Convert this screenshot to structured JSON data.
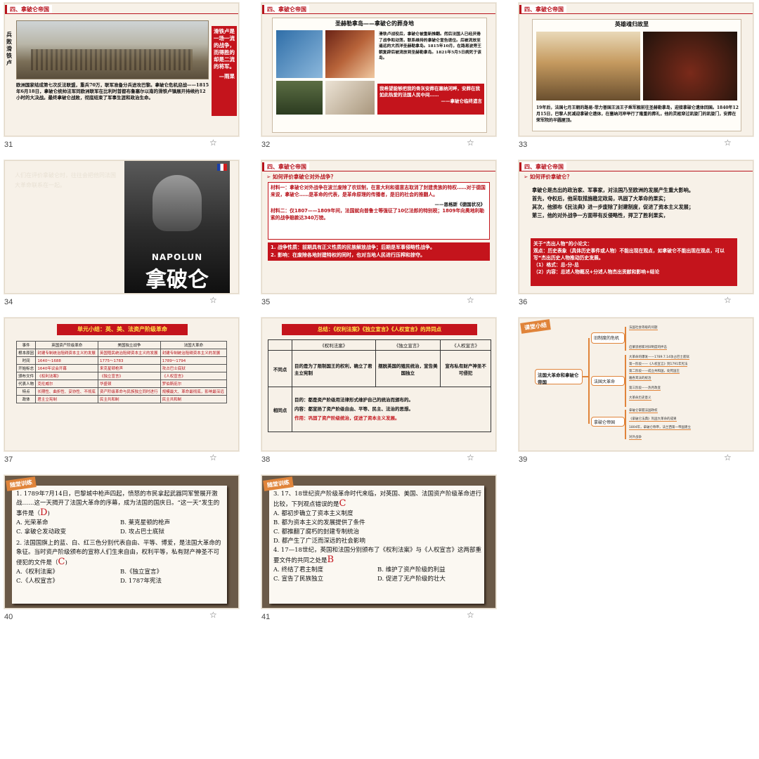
{
  "colors": {
    "accent_red": "#c4141c",
    "section_red": "#b8131c",
    "slide_bg": "#f7f1e8",
    "mind_orange": "#e0843a"
  },
  "slides": [
    {
      "num": "31",
      "section": "四、拿破仑帝国",
      "side_label": "兵败滑铁卢",
      "body": "欧洲国家结成第七次反法联盟，重兵70万，联军准备分兵进攻巴黎。拿破仑危机迎战——1815年6月18日，拿破仑统帅法军同欧洲联军在比利时首都布鲁塞尔以南的滑铁卢镇展开持续约12小时的大决战。最终拿破仑战败，彻底结束了军事生涯和政治生命。",
      "quote": "滑铁卢是一场一流的战争，而得胜的却是二流的将军。",
      "quote_author": "—雨果"
    },
    {
      "num": "32",
      "section": "四、拿破仑帝国",
      "heading": "圣赫勒拿岛——拿破仑的葬身地",
      "body": "滑铁卢战役后，拿破仑被重新推翻。然后法国人已经厌倦了战争和动荡，联系维持的拿破仑宣告退位。后被流放至遥远的大西洋圣赫勒拿岛。1815年10月，在路易波旁王朝复辟后被流放到圣赫勒拿岛。1821年5月5日病死于该岛。",
      "redbox": "我希望能够把我的骨灰安葬在塞纳河畔，安葬在我如此热爱的法国人民中间……",
      "redbox_author": "——拿破仑临终遗言"
    },
    {
      "num": "33",
      "section": "四、拿破仑帝国",
      "heading": "英雄魂归故里",
      "body": "19年后，法国七月王朝的路易-菲力普国王派王子乘军舰前往圣赫勒拿岛，迎接拿破仑遗体回国。1840年12月15日，巴黎人民减迎拿破仑遗体，在塞纳河岸举行了隆重的葬礼，他的灵柩穿过凯旋门的凯旋门，安葬在荣军院的半圆屋顶。"
    },
    {
      "num": "34",
      "poster_top": "NAPOLUN",
      "poster_title": "拿破仑",
      "bg_text": "人们在评价拿破仑时，往往会把他同法国大革命联系在一起。"
    },
    {
      "num": "35",
      "section": "四、拿破仑帝国",
      "question": "如何评价拿破仑对外战争？",
      "material1": "材料一：拿破仑对外战争在波兰废除了农奴制，在意大利和德意志取消了封建贵族的特权……对于德国来说，拿破仑……是革命的代表，是革命原理的传播者，是旧的社会的推翻人。",
      "material1_src": "——恩格斯《德国状况》",
      "material2": "材料二：仅1807——1809年间，法国就向普鲁士等强征了10亿法郎的特别税；1809年向奥地利勒索的战争赔款达340万镑。",
      "answer1": "1. 战争性质：前期具有正义性质的民族解放战争；后期是军事侵略性战争。",
      "answer2": "2. 影响：在废除各地封建特权的同时，也对当地人民进行压榨和掠夺。"
    },
    {
      "num": "36",
      "section": "四、拿破仑帝国",
      "question": "如何评价拿破仑？",
      "p1": "拿破仑是杰出的政治家、军事家，对法国乃至欧洲的发展产生重大影响。",
      "p2": "首先，夺权后，他采取措施稳定政局，巩固了大革命的果实；",
      "p3": "其次，他颁布《民法典》进一步废除了封建制度，促进了资本主义发展；",
      "p4": "第三，他的对外战争一方面带有反侵略性，捍卫了胜利果实，",
      "box_title": "关于“杰出人物”的小论文：",
      "box_body": "观点：历史表象（具体历史事件或人物）不能出现在观点，如拿破仑不能出现在观点，可以写“杰出历史人物推动历史发展。",
      "box_l1": "（1）格式：总-分-总",
      "box_l2": "（2）内容：总述人物概况+分述人物杰出贡献和影响+结论"
    },
    {
      "num": "37",
      "title": "单元小结：英、美、法资产阶级革命",
      "headers": [
        "事件",
        "英国资产阶级革命",
        "美国独立战争",
        "法国大革命"
      ],
      "rows": [
        [
          "根本原因",
          "封建专制统治阻碍资本主义的发展",
          "英国殖民统治阻碍资本主义的发展",
          "封建专制统治阻碍资本主义的发展"
        ],
        [
          "时间",
          "1640～1688",
          "1775～1783",
          "1789～1794"
        ],
        [
          "开始标志",
          "1640年议会开幕",
          "来克星顿枪声",
          "攻占巴士底狱"
        ],
        [
          "颁布文件",
          "《权利法案》",
          "《独立宣言》",
          "《人权宣言》"
        ],
        [
          "代表人物",
          "克伦威尔",
          "华盛顿",
          "罗伯斯庇尔"
        ],
        [
          "特点",
          "长期性、曲折性、妥协性、不彻底",
          "资产阶级革命与民族独立同时进行",
          "规模最大、革命最彻底，影响最深远"
        ],
        [
          "政体",
          "君主立宪制",
          "民主共和制",
          "民主共和制"
        ]
      ]
    },
    {
      "num": "38",
      "title": "总结：《权利法案》《独立宣言》《人权宣言》的异同点",
      "headers": [
        "",
        "《权利法案》",
        "《独立宣言》",
        "《人权宣言》"
      ],
      "diff_label": "不同点",
      "diff": [
        "目的是为了限制国王的权利，确立了君主立宪制",
        "摆脱英国的殖民统治，宣告美国独立",
        "宣布私有财产神圣不可侵犯"
      ],
      "same_label": "相同点",
      "same1": "目的：都是资产阶级用法律形式维护自己的统治而颁布的。",
      "same2": "内容：都宣扬了资产阶级自由、平等、民主、法治的思想。",
      "same3": "作用：巩固了资产阶级统治，促进了资本主义发展。"
    },
    {
      "num": "39",
      "tag": "课堂小结",
      "root": "法国大革命和拿破仑帝国",
      "branches": [
        "旧制度的危机",
        "法国大革命",
        "拿破仑帝国"
      ],
      "leaves": [
        "法国社会等级的问题",
        "启蒙思想家对旧制度的抨击",
        "大革命的爆发——1789.7.14攻占巴士底狱",
        "第一阶段——《人权宣言》到1791年宪法",
        "第二阶段——成立共和国，处死国王",
        "雅各宾派的统治",
        "第三阶段——热月政变",
        "大革命历史意义",
        "拿破仑掌握法国政权",
        "《拿破仑法典》巩固大革命的成果",
        "1804年，拿破仑称帝，法兰西第一帝国建立",
        "对外战争"
      ]
    },
    {
      "num": "40",
      "tag": "随堂训练",
      "q1": "1. 1789年7月14日，巴黎城中枪声四起，愤怒的市民拿起武器同军警展开激战……这一天揭开了法国大革命的序幕，成为法国的国庆日。“这一天”发生的事件是（",
      "q1_ans": "D",
      "q1_opts": [
        "A. 光荣革命",
        "B. 莱克星顿的枪声",
        "C. 拿破仑发动政变",
        "D. 攻占巴士底狱"
      ],
      "q2": "2. 法国国旗上的蓝、白、红三色分别代表自由、平等、博爱，是法国大革命的象征。当时资产阶级颁布的宣称人们生来自由，权利平等，私有财产神圣不可侵犯的文件是（",
      "q2_ans": "C",
      "q2_opts": [
        "A.《权利法案》",
        "B.《独立宣言》",
        "C.《人权宣言》",
        "D. 1787年宪法"
      ]
    },
    {
      "num": "41",
      "tag": "随堂训练",
      "q3": "3. 17、18世纪资产阶级革命时代来临，对英国、美国、法国资产阶级革命进行比较，下列观点错误的是",
      "q3_ans": "C",
      "q3_opts": [
        "A. 都初步确立了资本主义制度",
        "B. 都为资本主义的发展提供了条件",
        "C. 都推翻了腐朽的封建专制统治",
        "D. 都产生了广泛而深远的社会影响"
      ],
      "q4": "4. 17—18世纪，英国和法国分别颁布了《权利法案》与《人权宣言》这两部重要文件的共同之处是",
      "q4_ans": "B",
      "q4_opts": [
        "A. 终结了君主制度",
        "B. 维护了资产阶级的利益",
        "C. 宣告了民族独立",
        "D. 促进了无产阶级的壮大"
      ]
    }
  ],
  "star_icon": "☆"
}
